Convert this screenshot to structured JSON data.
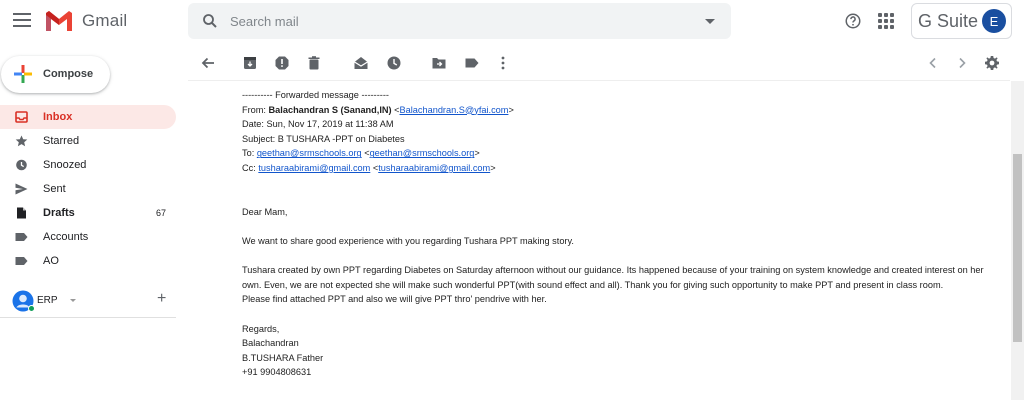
{
  "app": {
    "name": "Gmail"
  },
  "search": {
    "placeholder": "Search mail"
  },
  "gsuite": {
    "label": "G Suite",
    "avatar_initial": "E"
  },
  "compose": {
    "label": "Compose"
  },
  "sidebar": {
    "items": [
      {
        "label": "Inbox",
        "count": ""
      },
      {
        "label": "Starred",
        "count": ""
      },
      {
        "label": "Snoozed",
        "count": ""
      },
      {
        "label": "Sent",
        "count": ""
      },
      {
        "label": "Drafts",
        "count": "67"
      },
      {
        "label": "Accounts",
        "count": ""
      },
      {
        "label": "AO",
        "count": ""
      }
    ]
  },
  "hangouts": {
    "user": "ERP"
  },
  "message": {
    "fwd_header": "---------- Forwarded message ---------",
    "from_label": "From: ",
    "from_name": "Balachandran S (Sanand,IN)",
    "from_email": "Balachandran.S@yfai.com",
    "date": "Date: Sun, Nov 17, 2019 at 11:38 AM",
    "subject": "Subject: B TUSHARA -PPT on Diabetes",
    "to_label": "To: ",
    "to_email": "geethan@srmschools.org",
    "cc_label": "Cc: ",
    "cc_email": "tusharaabirami@gmail.com",
    "greeting": "Dear Mam,",
    "para1": "We want to share good experience with you regarding Tushara PPT making story.",
    "para2a": "Tushara created by own PPT regarding Diabetes on Saturday afternoon without our guidance. Its happened because of your training on system knowledge and created interest on her own. Even, we are not expected she will make such wonderful PPT(with sound effect and all). Thank you for giving such opportunity to make PPT and present in class room.",
    "para2b": "Please find attached PPT and also we will give PPT thro' pendrive with her.",
    "sig1": "Regards,",
    "sig2": "Balachandran",
    "sig3": "B.TUSHARA Father",
    "sig4": "+91 9904808631"
  },
  "colors": {
    "accent": "#d93025",
    "active_bg": "#fce8e6",
    "link": "#1155cc"
  }
}
